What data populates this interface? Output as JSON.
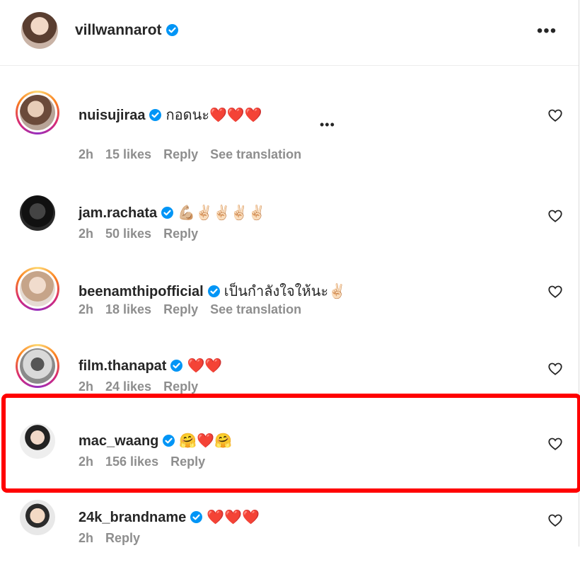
{
  "header": {
    "username": "villwannarot",
    "more_icon": "more-horizontal-icon"
  },
  "colors": {
    "highlight": "#ff0000",
    "verified": "#0095f6",
    "heart": "#e0245e",
    "meta": "#8e8e8e"
  },
  "comments": [
    {
      "username": "nuisujiraa",
      "text": "กอดนะ❤️❤️❤️",
      "time": "2h",
      "likes": "15 likes",
      "reply": "Reply",
      "translation": "See translation",
      "story_ring": true
    },
    {
      "username": "jam.rachata",
      "text": "💪🏼✌🏻✌🏻✌🏻✌🏻",
      "time": "2h",
      "likes": "50 likes",
      "reply": "Reply",
      "story_ring": false
    },
    {
      "username": "beenamthipofficial",
      "text": "เป็นกำลังใจให้นะ✌🏻",
      "time": "2h",
      "likes": "18 likes",
      "reply": "Reply",
      "translation": "See translation",
      "story_ring": true
    },
    {
      "username": "film.thanapat",
      "text": "❤️❤️",
      "time": "2h",
      "likes": "24 likes",
      "reply": "Reply",
      "story_ring": true
    },
    {
      "username": "mac_waang",
      "text": "🤗❤️🤗",
      "time": "2h",
      "likes": "156 likes",
      "reply": "Reply",
      "story_ring": false,
      "highlighted": true
    },
    {
      "username": "24k_brandname",
      "text": "❤️❤️❤️",
      "time": "2h",
      "reply": "Reply",
      "story_ring": false
    }
  ]
}
